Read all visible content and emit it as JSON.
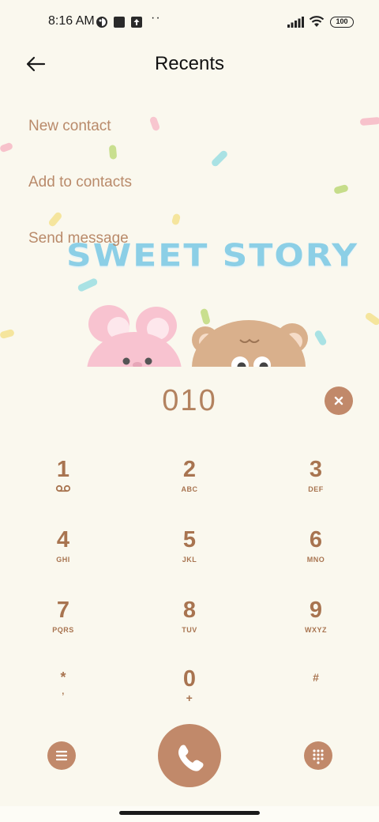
{
  "status_bar": {
    "time": "8:16 AM",
    "battery": "100",
    "icons": [
      "theme-icon",
      "app-notification-icon",
      "upload-icon",
      "more-dots-icon",
      "signal-icon",
      "wifi-icon",
      "battery-icon"
    ],
    "dots": "··"
  },
  "header": {
    "title": "Recents",
    "back_icon": "arrow-left-icon"
  },
  "menu": {
    "new_contact": "New contact",
    "add_to_contacts": "Add to contacts",
    "send_message": "Send message"
  },
  "decoration": {
    "title": "SWEET STORY"
  },
  "dial": {
    "number": "010",
    "delete_icon": "close-icon"
  },
  "keypad": [
    {
      "digit": "1",
      "letters": "",
      "icon": "voicemail-icon"
    },
    {
      "digit": "2",
      "letters": "ABC"
    },
    {
      "digit": "3",
      "letters": "DEF"
    },
    {
      "digit": "4",
      "letters": "GHI"
    },
    {
      "digit": "5",
      "letters": "JKL"
    },
    {
      "digit": "6",
      "letters": "MNO"
    },
    {
      "digit": "7",
      "letters": "PQRS"
    },
    {
      "digit": "8",
      "letters": "TUV"
    },
    {
      "digit": "9",
      "letters": "WXYZ"
    },
    {
      "digit": "*",
      "letters": ","
    },
    {
      "digit": "0",
      "letters": "+"
    },
    {
      "digit": "#",
      "letters": ""
    }
  ],
  "bottom_bar": {
    "menu_icon": "menu-icon",
    "call_icon": "phone-icon",
    "keypad_icon": "dialpad-icon"
  },
  "colors": {
    "background": "#faf8ee",
    "accent": "#c1896a",
    "key_text": "#a87450",
    "menu_text": "#b98a6a",
    "sweet_title": "#8ccfe6"
  }
}
